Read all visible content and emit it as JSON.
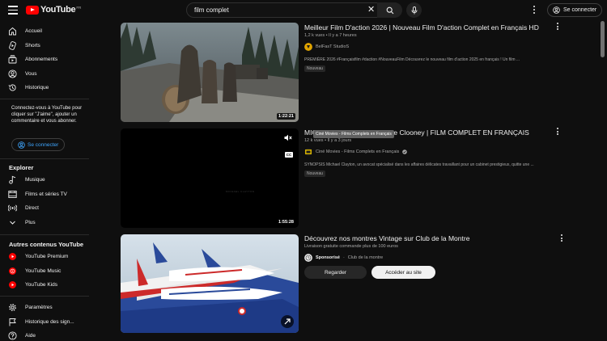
{
  "header": {
    "logo_text": "YouTube",
    "logo_country": "FR",
    "search_value": "film complet",
    "signin_label": "Se connecter"
  },
  "sidebar": {
    "main": [
      {
        "label": "Accueil",
        "icon": "home-icon"
      },
      {
        "label": "Shorts",
        "icon": "shorts-icon"
      },
      {
        "label": "Abonnements",
        "icon": "subscriptions-icon"
      },
      {
        "label": "Vous",
        "icon": "user-icon"
      },
      {
        "label": "Historique",
        "icon": "history-icon"
      }
    ],
    "promo_text": "Connectez-vous à YouTube pour cliquer sur \"J'aime\", ajouter un commentaire et vous abonner.",
    "signin_label": "Se connecter",
    "explore_title": "Explorer",
    "explore": [
      {
        "label": "Musique",
        "icon": "music-icon"
      },
      {
        "label": "Films et séries TV",
        "icon": "film-icon"
      },
      {
        "label": "Direct",
        "icon": "live-icon"
      },
      {
        "label": "Plus",
        "icon": "chevron-down-icon"
      }
    ],
    "other_title": "Autres contenus YouTube",
    "other": [
      {
        "label": "YouTube Premium",
        "icon": "youtube-premium-icon"
      },
      {
        "label": "YouTube Music",
        "icon": "youtube-music-icon"
      },
      {
        "label": "YouTube Kids",
        "icon": "youtube-kids-icon"
      }
    ],
    "settings": [
      {
        "label": "Paramètres",
        "icon": "gear-icon"
      },
      {
        "label": "Historique des sign...",
        "icon": "flag-icon"
      },
      {
        "label": "Aide",
        "icon": "help-icon"
      }
    ]
  },
  "results": [
    {
      "title": "Meilleur Film D'action 2026 | Nouveau Film D'action Complet en Français HD",
      "meta": "1,2 k vues • Il y a 7 heures",
      "channel": "BelFasT StudioS",
      "description": "PREMIÈRE 2026 #Françaisfilm #daction #NouveauFilm Découvrez le nouveau film d'action 2025 en français ! Un film ...",
      "badge": "Nouveau",
      "duration": "1:22:21"
    },
    {
      "title": "MICHAEL CLAYTON - George Clooney | FILM COMPLET EN FRANÇAIS",
      "meta": "12 k vues • Il y a 3 jours",
      "channel": "Ciné Movies - Films Complets en Français",
      "description": "SYNOPSIS Michael Clayton, un avocat spécialisé dans les affaires délicates travaillant pour un cabinet prestigieux, quitte une ...",
      "badge": "Nouveau",
      "duration": "1:55:28",
      "tooltip": "Ciné Movies - Films Complets en Français",
      "thumb_watermark": "MICHAEL CLAYTON",
      "cc_label": "CC"
    },
    {
      "title": "Découvrez nos montres Vintage sur Club de la Montre",
      "meta": "Livraison gratuite commande plus de 100 euros",
      "sponsor_label": "Sponsorisé",
      "channel": "Club de la montre",
      "button_primary": "Regarder",
      "button_secondary": "Accéder au site"
    }
  ],
  "colors": {
    "background": "#0f0f0f",
    "accent_blue": "#3ea6ff",
    "logo_red": "#ff0000"
  }
}
